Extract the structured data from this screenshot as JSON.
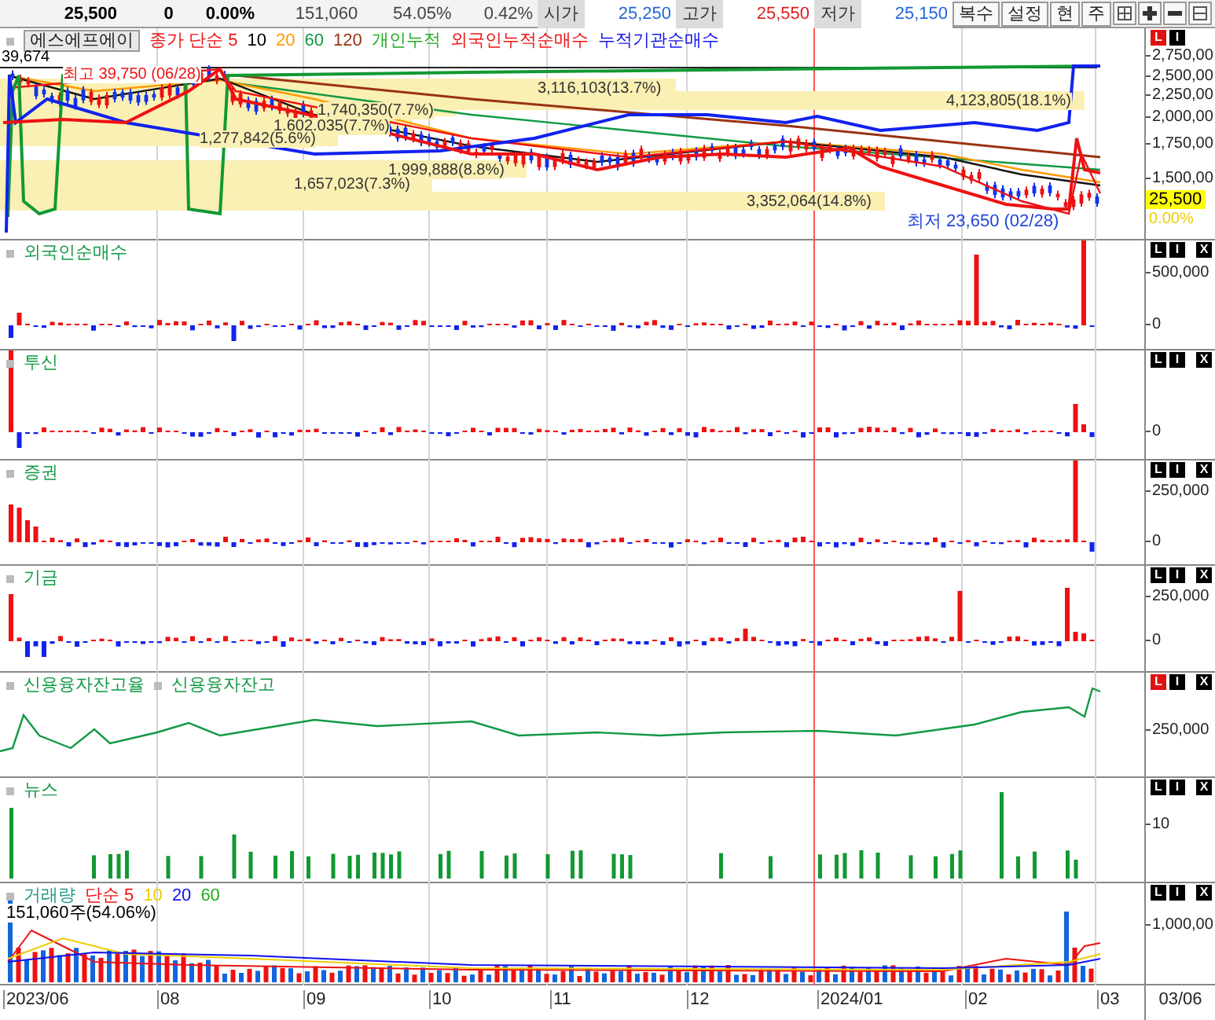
{
  "quote_bar": {
    "price": "25,500",
    "change": "0",
    "change_rate": "0.00%",
    "volume": "151,060",
    "volume_ratio": "54.05%",
    "turnover_rate": "0.42%",
    "fields": [
      {
        "label": "시가",
        "value": "25,250",
        "color": "#2266dd"
      },
      {
        "label": "고가",
        "value": "25,550",
        "color": "#e02020"
      },
      {
        "label": "저가",
        "value": "25,150",
        "color": "#2266dd"
      }
    ],
    "buttons": [
      "복수",
      "설정",
      "현",
      "주"
    ]
  },
  "main_panel": {
    "stock_name": "에스에프에이",
    "legend": [
      {
        "text": "종가 단순 5",
        "color": "#ee1111"
      },
      {
        "text": "10",
        "color": "#000000"
      },
      {
        "text": "20",
        "color": "#ff9900"
      },
      {
        "text": "60",
        "color": "#119944"
      },
      {
        "text": "120",
        "color": "#993311"
      },
      {
        "text": "개인누적",
        "color": "#22aa22"
      },
      {
        "text": "외국인누적순매수",
        "color": "#ee1111"
      },
      {
        "text": "누적기관순매수",
        "color": "#1111ee"
      }
    ],
    "top_value": "39,674",
    "high_note": "최고 39,750 (06/28)",
    "low_note": "최저 23,650 (02/28)",
    "volume_profile": [
      "3,116,103(13.7%)",
      "4,123,805(18.1%)",
      "1,740,350(7.7%)",
      "1,602,035(7.7%)",
      "1,277,842(5.6%)",
      "1,999,888(8.8%)",
      "1,657,023(7.3%)",
      "3,352,064(14.8%)"
    ],
    "axis_labels": [
      "2,750,00",
      "2,500,00",
      "2,250,00",
      "2,000,00",
      "1,750,00",
      "1,500,00"
    ],
    "current_price": "25,500",
    "current_change": "0.00%",
    "buttons": [
      {
        "label": "L",
        "on": true
      },
      {
        "label": "I",
        "on": false
      }
    ]
  },
  "panels": [
    {
      "kind": "bars",
      "legend": [
        {
          "text": "외국인순매수",
          "color": "#119944"
        }
      ],
      "axis_labels": [
        "500,000",
        "0"
      ],
      "buttons": [
        {
          "label": "L",
          "on": false
        },
        {
          "label": "I",
          "on": false
        },
        {
          "label": "X",
          "on": false
        }
      ]
    },
    {
      "kind": "bars",
      "legend": [
        {
          "text": "투신",
          "color": "#119944"
        }
      ],
      "axis_labels": [
        "0"
      ],
      "buttons": [
        {
          "label": "L",
          "on": false
        },
        {
          "label": "I",
          "on": false
        },
        {
          "label": "X",
          "on": false
        }
      ]
    },
    {
      "kind": "bars",
      "legend": [
        {
          "text": "증권",
          "color": "#119944"
        }
      ],
      "axis_labels": [
        "250,000",
        "0"
      ],
      "buttons": [
        {
          "label": "L",
          "on": false
        },
        {
          "label": "I",
          "on": false
        },
        {
          "label": "X",
          "on": false
        }
      ]
    },
    {
      "kind": "bars",
      "legend": [
        {
          "text": "기금",
          "color": "#119944"
        }
      ],
      "axis_labels": [
        "250,000",
        "0"
      ],
      "buttons": [
        {
          "label": "L",
          "on": false
        },
        {
          "label": "I",
          "on": false
        },
        {
          "label": "X",
          "on": false
        }
      ]
    },
    {
      "kind": "line",
      "legend": [
        {
          "text": "신용융자잔고율",
          "color": "#119944"
        },
        {
          "text": "신용융자잔고",
          "color": "#119944"
        }
      ],
      "axis_labels": [
        "250,000"
      ],
      "buttons": [
        {
          "label": "L",
          "on": true
        },
        {
          "label": "I",
          "on": false
        },
        {
          "label": "X",
          "on": false
        }
      ]
    },
    {
      "kind": "news",
      "legend": [
        {
          "text": "뉴스",
          "color": "#119944"
        }
      ],
      "axis_labels": [
        "10"
      ],
      "buttons": [
        {
          "label": "L",
          "on": false
        },
        {
          "label": "I",
          "on": false
        },
        {
          "label": "X",
          "on": false
        }
      ]
    },
    {
      "kind": "volume",
      "legend": [
        {
          "text": "거래량",
          "color": "#229988"
        },
        {
          "text": "단순 5",
          "color": "#ee1111"
        },
        {
          "text": "10",
          "color": "#eecc00"
        },
        {
          "text": "20",
          "color": "#1111ee"
        },
        {
          "text": "60",
          "color": "#22aa22"
        }
      ],
      "note": "151,060주(54.06%)",
      "axis_labels": [
        "1,000,00"
      ],
      "buttons": [
        {
          "label": "L",
          "on": false
        },
        {
          "label": "I",
          "on": false
        },
        {
          "label": "X",
          "on": false
        }
      ]
    }
  ],
  "x_axis": {
    "labels": [
      "2023/06",
      "08",
      "09",
      "10",
      "11",
      "12",
      "2024/01",
      "02",
      "03"
    ],
    "last_date": "03/06"
  }
}
